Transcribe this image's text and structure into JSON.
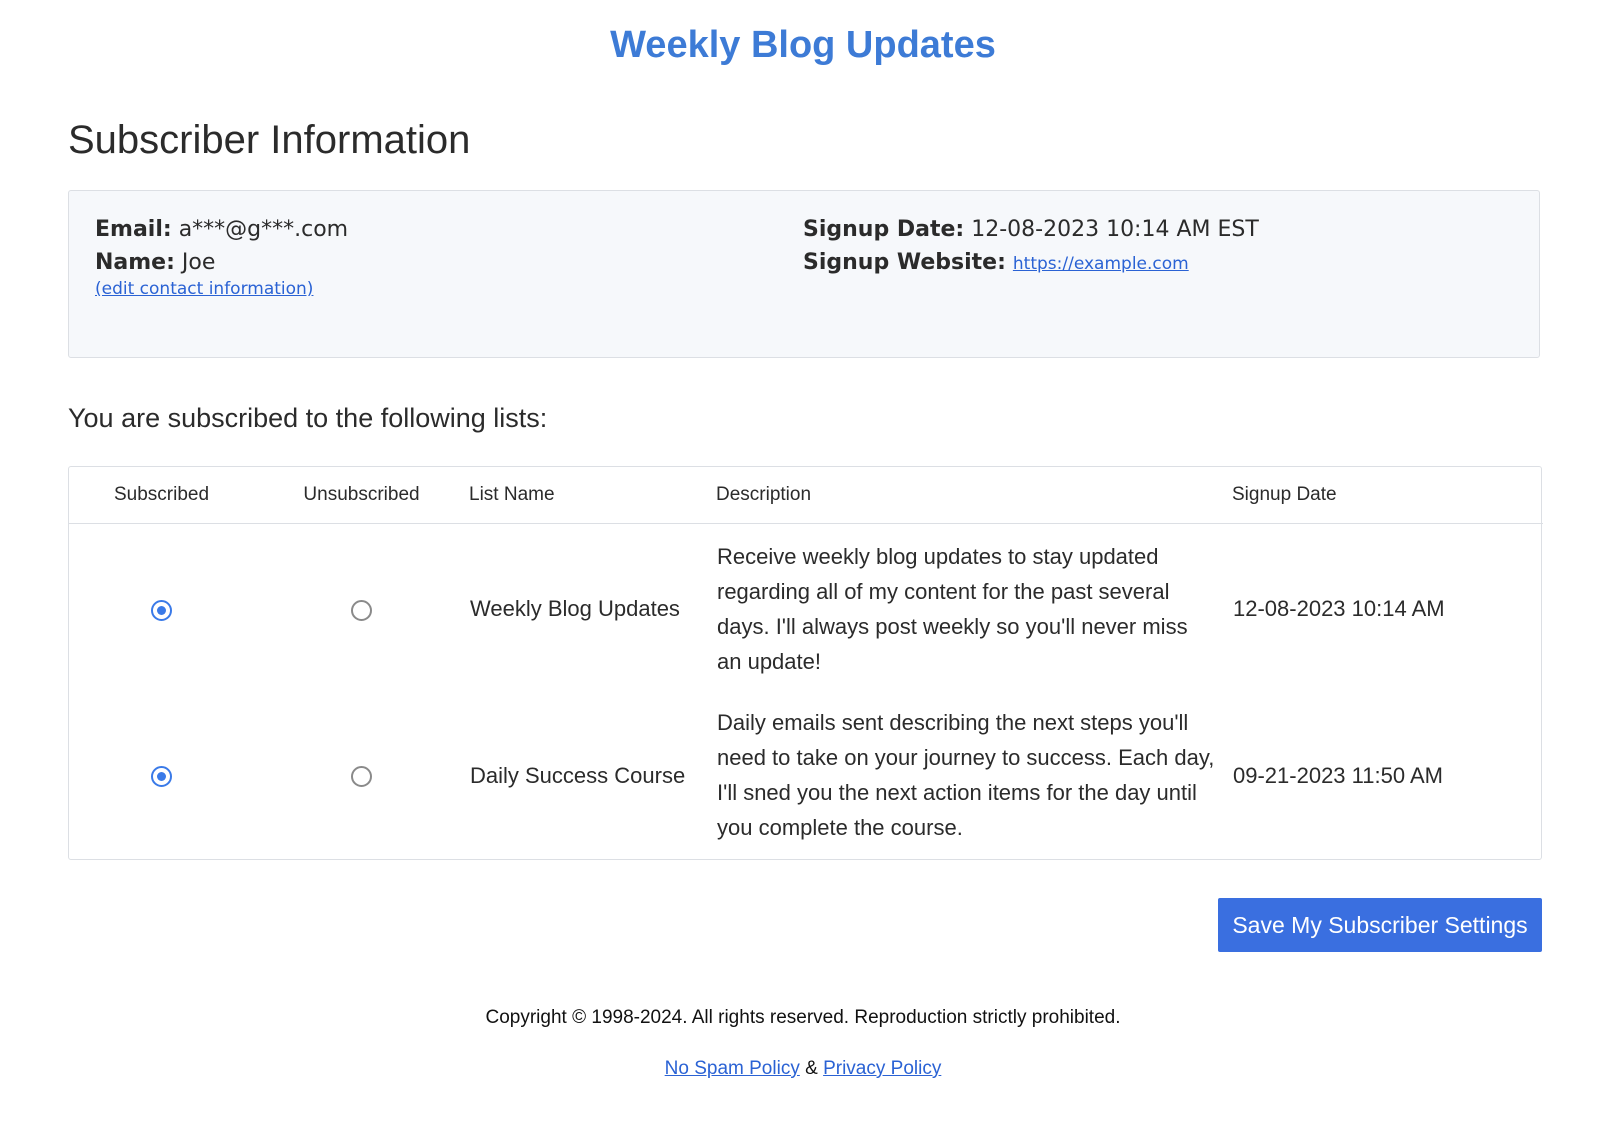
{
  "header": {
    "title": "Weekly Blog Updates"
  },
  "subscriber": {
    "heading": "Subscriber Information",
    "email_label": "Email:",
    "email_value": "a***@g***.com",
    "name_label": "Name:",
    "name_value": "Joe",
    "edit_link": "(edit contact information)",
    "signup_date_label": "Signup Date:",
    "signup_date_value": "12-08-2023 10:14 AM EST",
    "signup_website_label": "Signup Website:",
    "signup_website_value": "https://example.com"
  },
  "lists": {
    "heading": "You are subscribed to the following lists:",
    "columns": [
      "Subscribed",
      "Unsubscribed",
      "List Name",
      "Description",
      "Signup Date"
    ],
    "rows": [
      {
        "subscribed": true,
        "name": "Weekly Blog Updates",
        "description": "Receive weekly blog updates to stay updated regarding all of my content for the past several days. I'll always post weekly so you'll never miss an update!",
        "signup_date": "12-08-2023 10:14 AM"
      },
      {
        "subscribed": true,
        "name": "Daily Success Course",
        "description": "Daily emails sent describing the next steps you'll need to take on your journey to success. Each day, I'll sned you the next action items for the day until you complete the course.",
        "signup_date": "09-21-2023 11:50 AM"
      }
    ]
  },
  "actions": {
    "save_label": "Save My Subscriber Settings"
  },
  "footer": {
    "copyright": "Copyright © 1998-2024. All rights reserved. Reproduction strictly prohibited.",
    "no_spam_link": "No Spam Policy",
    "separator": "&",
    "privacy_link": "Privacy Policy"
  },
  "colors": {
    "accent": "#3d7bd6",
    "button": "#3a6fe0",
    "link": "#2a62d4",
    "radio_checked": "#3a7ae8"
  }
}
